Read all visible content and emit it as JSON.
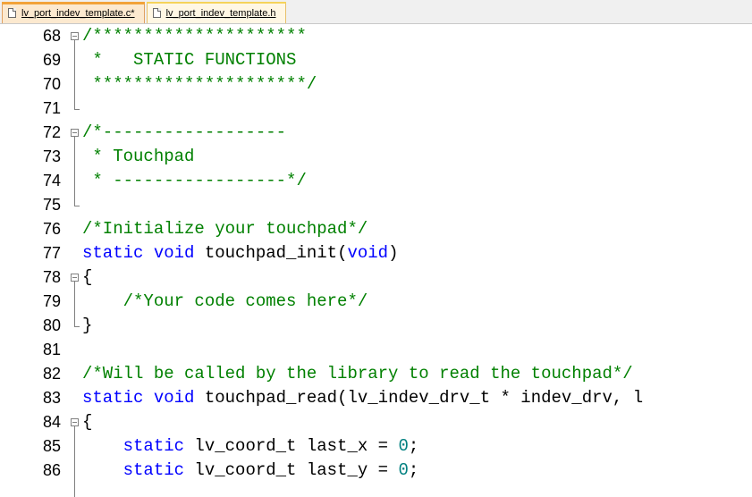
{
  "tabs": [
    {
      "label": "lv_port_indev_template.c*",
      "active": true
    },
    {
      "label": "lv_port_indev_template.h",
      "active": false
    }
  ],
  "lines": [
    {
      "n": "68",
      "tokens": [
        {
          "t": "/*********************",
          "c": "cmt"
        }
      ]
    },
    {
      "n": "69",
      "tokens": [
        {
          "t": " *   STATIC FUNCTIONS",
          "c": "cmt"
        }
      ]
    },
    {
      "n": "70",
      "tokens": [
        {
          "t": " *********************/",
          "c": "cmt"
        }
      ]
    },
    {
      "n": "71",
      "tokens": []
    },
    {
      "n": "72",
      "tokens": [
        {
          "t": "/*------------------",
          "c": "cmt"
        }
      ]
    },
    {
      "n": "73",
      "tokens": [
        {
          "t": " * Touchpad",
          "c": "cmt"
        }
      ]
    },
    {
      "n": "74",
      "tokens": [
        {
          "t": " * -----------------*/",
          "c": "cmt"
        }
      ]
    },
    {
      "n": "75",
      "tokens": []
    },
    {
      "n": "76",
      "tokens": [
        {
          "t": "/*Initialize your touchpad*/",
          "c": "cmt"
        }
      ]
    },
    {
      "n": "77",
      "tokens": [
        {
          "t": "static",
          "c": "kw"
        },
        {
          "t": " ",
          "c": ""
        },
        {
          "t": "void",
          "c": "kw"
        },
        {
          "t": " touchpad_init(",
          "c": ""
        },
        {
          "t": "void",
          "c": "kw"
        },
        {
          "t": ")",
          "c": ""
        }
      ]
    },
    {
      "n": "78",
      "tokens": [
        {
          "t": "{",
          "c": ""
        }
      ]
    },
    {
      "n": "79",
      "tokens": [
        {
          "t": "    ",
          "c": ""
        },
        {
          "t": "/*Your code comes here*/",
          "c": "cmt"
        }
      ]
    },
    {
      "n": "80",
      "tokens": [
        {
          "t": "}",
          "c": ""
        }
      ]
    },
    {
      "n": "81",
      "tokens": []
    },
    {
      "n": "82",
      "tokens": [
        {
          "t": "/*Will be called by the library to read the touchpad*/",
          "c": "cmt"
        }
      ]
    },
    {
      "n": "83",
      "tokens": [
        {
          "t": "static",
          "c": "kw"
        },
        {
          "t": " ",
          "c": ""
        },
        {
          "t": "void",
          "c": "kw"
        },
        {
          "t": " touchpad_read(lv_indev_drv_t * indev_drv, l",
          "c": ""
        }
      ]
    },
    {
      "n": "84",
      "tokens": [
        {
          "t": "{",
          "c": ""
        }
      ]
    },
    {
      "n": "85",
      "tokens": [
        {
          "t": "    ",
          "c": ""
        },
        {
          "t": "static",
          "c": "kw"
        },
        {
          "t": " lv_coord_t last_x = ",
          "c": ""
        },
        {
          "t": "0",
          "c": "num"
        },
        {
          "t": ";",
          "c": ""
        }
      ]
    },
    {
      "n": "86",
      "tokens": [
        {
          "t": "    ",
          "c": ""
        },
        {
          "t": "static",
          "c": "kw"
        },
        {
          "t": " lv_coord_t last_y = ",
          "c": ""
        },
        {
          "t": "0",
          "c": "num"
        },
        {
          "t": ";",
          "c": ""
        }
      ]
    }
  ],
  "colors": {
    "comment": "#008000",
    "keyword": "#0000ff",
    "number": "#008080",
    "active_tab_accent": "#f2a33a"
  }
}
